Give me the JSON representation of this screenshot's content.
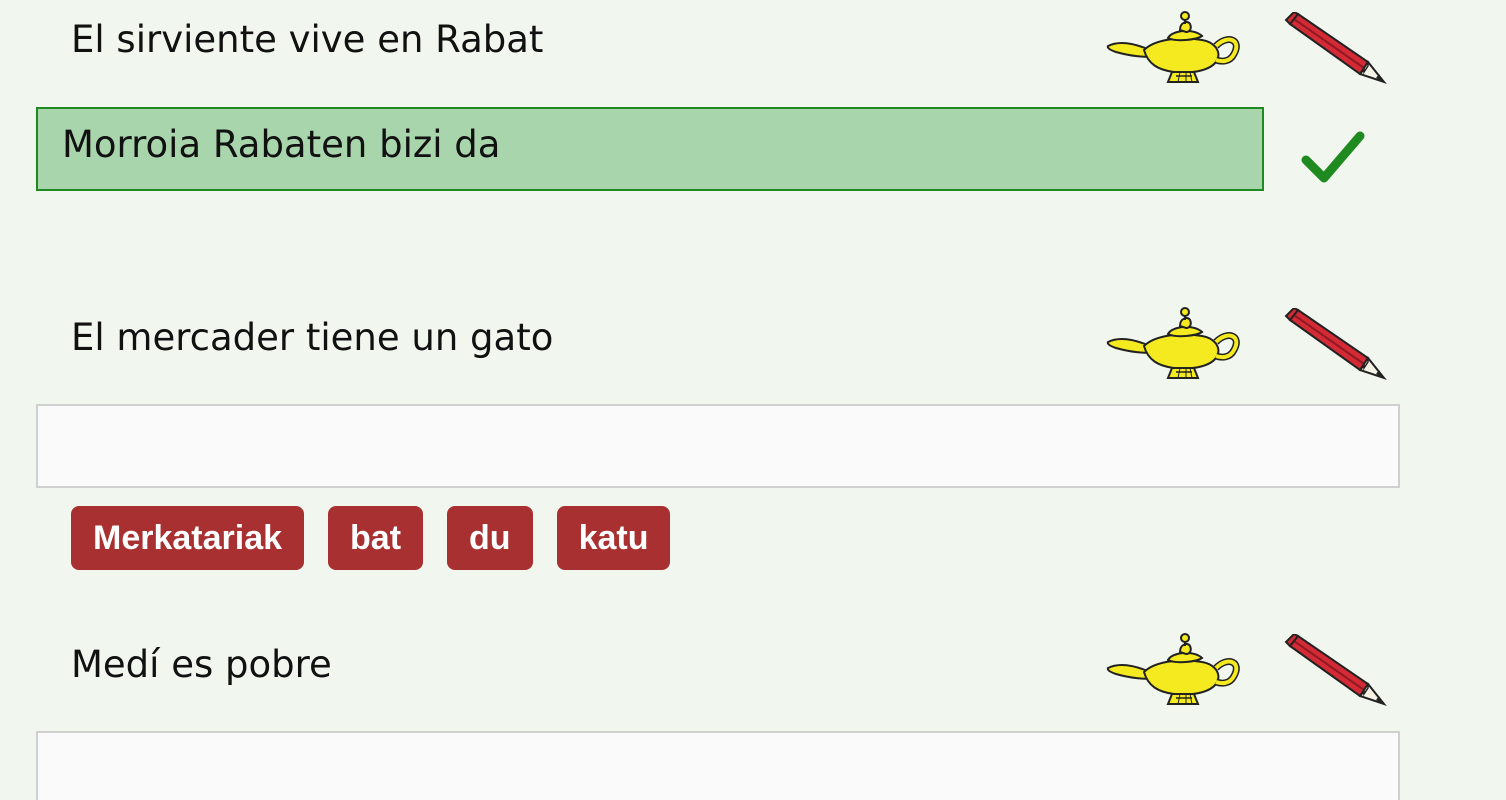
{
  "exercises": [
    {
      "prompt": "El sirviente vive en Rabat",
      "answer": "Morroia Rabaten bizi da",
      "status": "correct",
      "chips": []
    },
    {
      "prompt": "El mercader tiene un gato",
      "answer": "",
      "status": "empty",
      "chips": [
        "Merkatariak",
        "bat",
        "du",
        "katu"
      ]
    },
    {
      "prompt": "Medí es pobre",
      "answer": "",
      "status": "empty",
      "chips": []
    }
  ],
  "icons": {
    "hint": "genie-lamp-icon",
    "edit": "pencil-icon",
    "correct": "checkmark-icon"
  },
  "colors": {
    "background": "#f1f7ef",
    "correct_fill": "#a8d5ac",
    "correct_border": "#1f8a1f",
    "chip": "#a83030",
    "checkmark": "#1f8a1f",
    "pencil": "#d42a35",
    "lamp": "#f5ea1f"
  }
}
